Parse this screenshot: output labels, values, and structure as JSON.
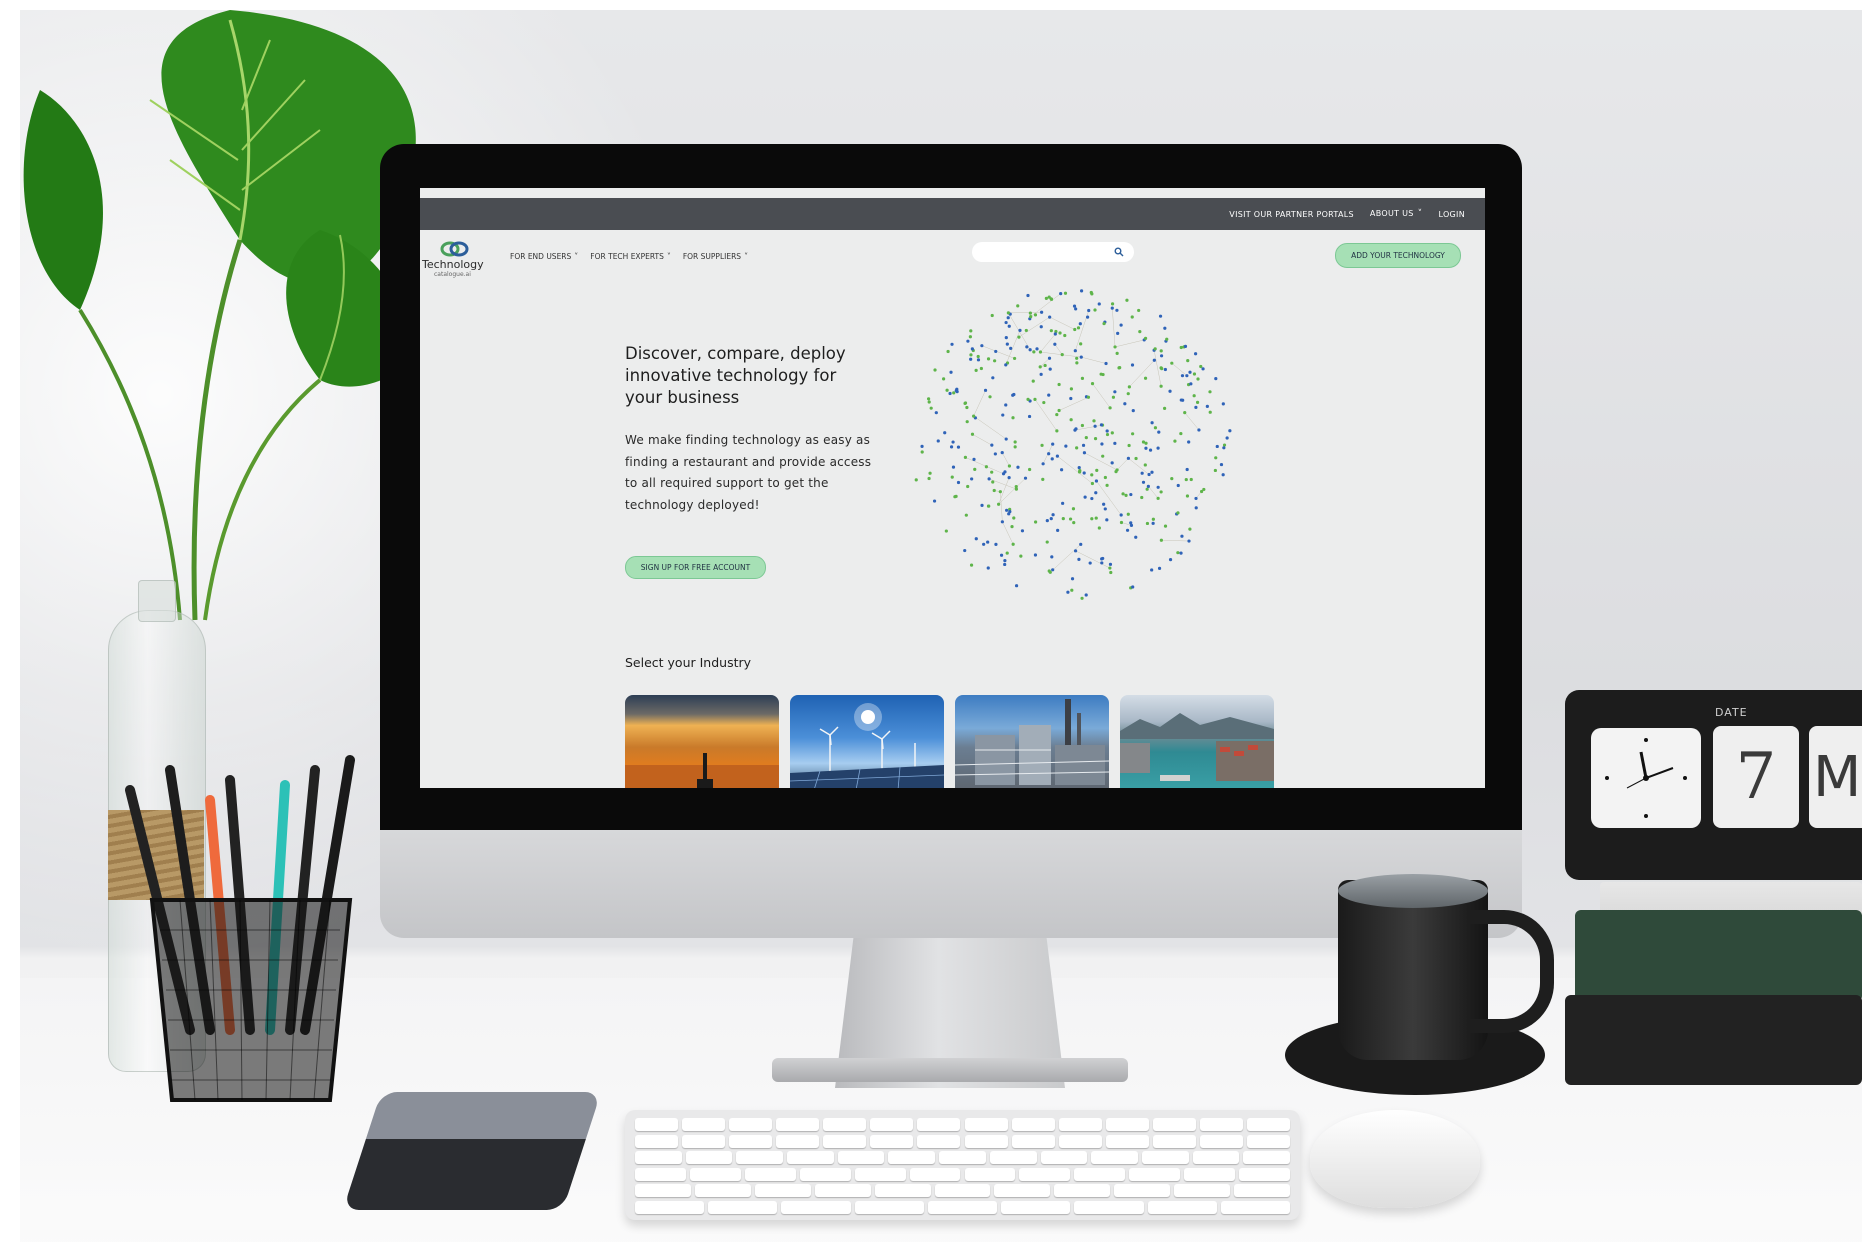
{
  "site": {
    "topbar": {
      "partner_portals": "VISIT OUR PARTNER PORTALS",
      "about_us": "ABOUT US",
      "login": "LOGIN"
    },
    "logo": {
      "name": "Technology",
      "tagline": "catalogue.ai"
    },
    "nav": [
      {
        "label": "FOR END USERS"
      },
      {
        "label": "FOR TECH EXPERTS"
      },
      {
        "label": "FOR SUPPLIERS"
      }
    ],
    "search": {
      "placeholder": "",
      "value": ""
    },
    "add_technology_label": "ADD YOUR TECHNOLOGY",
    "hero": {
      "title": "Discover, compare, deploy innovative technology for your business",
      "body": "We make finding technology as easy as finding a restaurant and provide access to all required support to get the technology deployed!",
      "signup_label": "SIGN UP FOR FREE ACCOUNT"
    },
    "industry": {
      "title": "Select your Industry",
      "tiles": [
        "oil-and-gas",
        "renewable-energy",
        "process-industry",
        "ports-and-shipping"
      ]
    },
    "colors": {
      "topbar": "#4a4d52",
      "accent_green": "#a6e0b5",
      "accent_green_border": "#7cc894",
      "background": "#eceded"
    }
  },
  "clock": {
    "date_label": "DATE",
    "day": "7",
    "month_fragment": "M"
  }
}
